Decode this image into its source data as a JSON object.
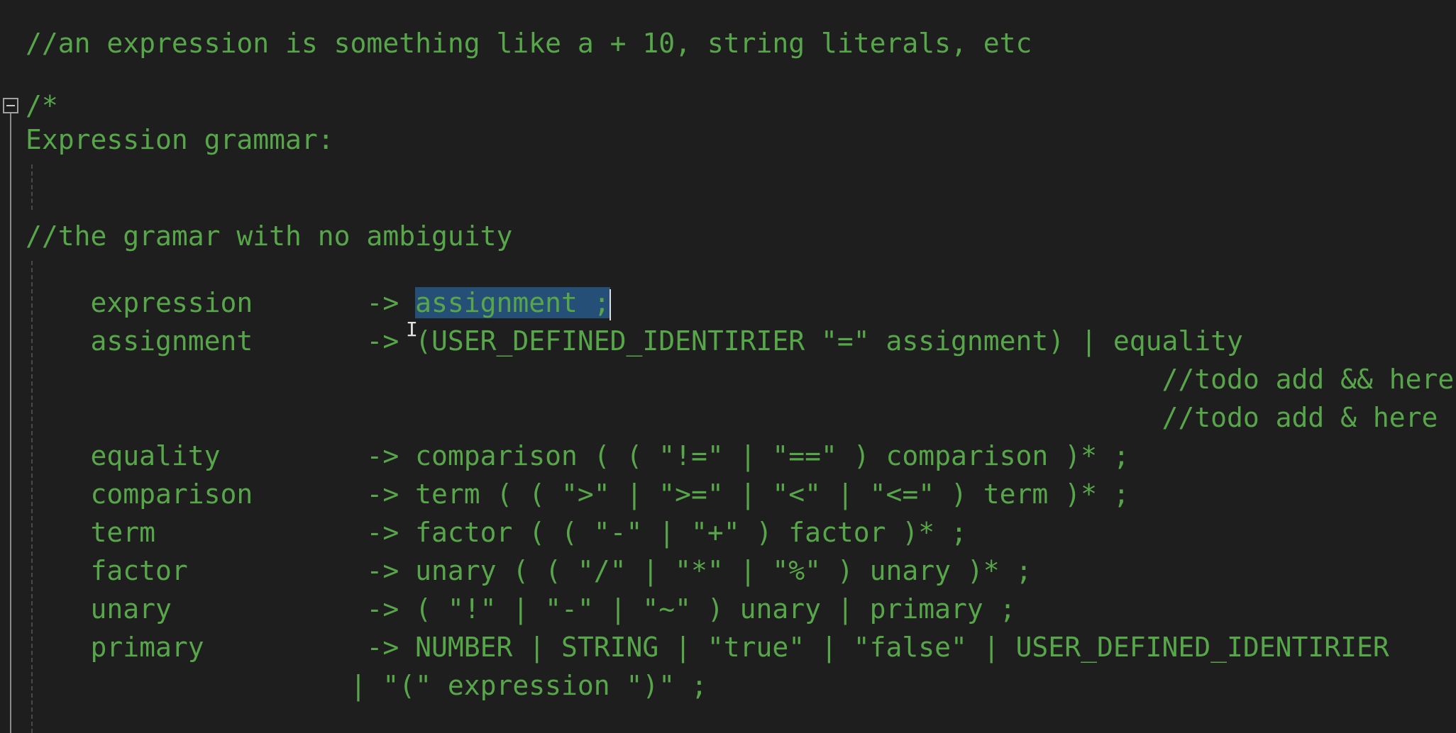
{
  "editor": {
    "language_hint": "comment",
    "lines": {
      "l1": "//an expression is something like a + 10, string literals, etc",
      "l2": "/*",
      "l3": "Expression grammar:",
      "l4": "//the gramar with no ambiguity",
      "expression_prefix": "    expression       -> ",
      "expression_selected": "assignment ;",
      "assignment": "    assignment       -> (USER_DEFINED_IDENTIRIER \"=\" assignment) | equality",
      "todo1": "                                                                      //todo add && here",
      "todo2": "                                                                      //todo add & here ?",
      "equality": "    equality         -> comparison ( ( \"!=\" | \"==\" ) comparison )* ;",
      "comparison": "    comparison       -> term ( ( \">\" | \">=\" | \"<\" | \"<=\" ) term )* ;",
      "term": "    term             -> factor ( ( \"-\" | \"+\" ) factor )* ;",
      "factor": "    factor           -> unary ( ( \"/\" | \"*\" | \"%\" ) unary )* ;",
      "unary": "    unary            -> ( \"!\" | \"-\" | \"~\" ) unary | primary ;",
      "primary": "    primary          -> NUMBER | STRING | \"true\" | \"false\" | USER_DEFINED_IDENTIRIER",
      "primary_cont": "                    | \"(\" expression \")\" ;"
    },
    "colors": {
      "background": "#1e1e1e",
      "comment_text": "#57a64a",
      "selection": "#264f78"
    },
    "icons": {
      "fold": "collapse-minus-icon",
      "cursor": "text-cursor-ibeam-icon"
    }
  }
}
